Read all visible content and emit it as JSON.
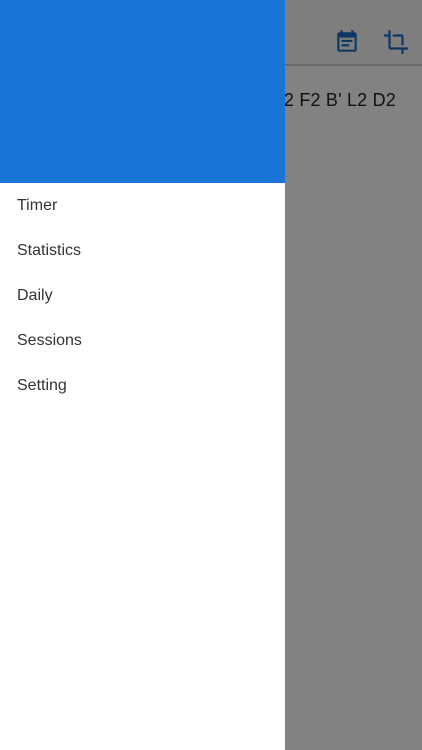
{
  "app": {
    "scramble_visible": "D2 F2 B' L2 D2",
    "toolbar": {
      "icons": [
        "calendar-icon",
        "crop-icon"
      ],
      "icon_color": "#1a6fc4"
    }
  },
  "drawer": {
    "header_color": "#1976d8",
    "menu": {
      "items": [
        {
          "label": "Timer"
        },
        {
          "label": "Statistics"
        },
        {
          "label": "Daily"
        },
        {
          "label": "Sessions"
        },
        {
          "label": "Setting"
        }
      ]
    }
  }
}
